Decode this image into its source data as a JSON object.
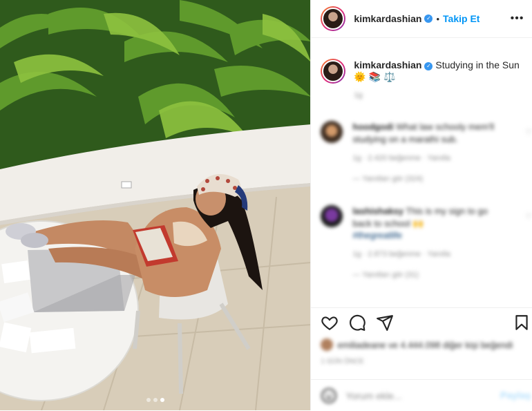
{
  "post": {
    "username": "kimkardashian",
    "separator": "•",
    "follow_label": "Takip Et",
    "more_label": "•••",
    "caption": "Studying in the Sun",
    "caption_emojis": "🌞 📚 ⚖️",
    "caption_time": "1g",
    "photo_dots": 3,
    "active_dot": 3
  },
  "comments": [
    {
      "username": "hoodgodi",
      "text": "What law schooly mem'll studying on a marathi sub.",
      "meta": "1g · 2.420 beğenme · Yanıtla",
      "replies": "— Yanıtları gör (324)"
    },
    {
      "username": "lashishaksy",
      "text": "This is my sign to go back to school 🙌",
      "hashtag": "#thegreatlife",
      "meta": "1g · 2.873 beğenme · Yanıtla",
      "replies": "— Yanıtları gör (31)"
    }
  ],
  "actions": {
    "likes_text": "emiliadeane ve 4.444.098 diğer kişi beğendi",
    "time_text": "1 GÜN ÖNCE"
  },
  "composer": {
    "placeholder": "Yorum ekle...",
    "post_label": "Paylaş"
  },
  "colors": {
    "accent": "#0095f6",
    "verified": "#3897f0",
    "text": "#262626",
    "muted": "#8e8e8e"
  }
}
